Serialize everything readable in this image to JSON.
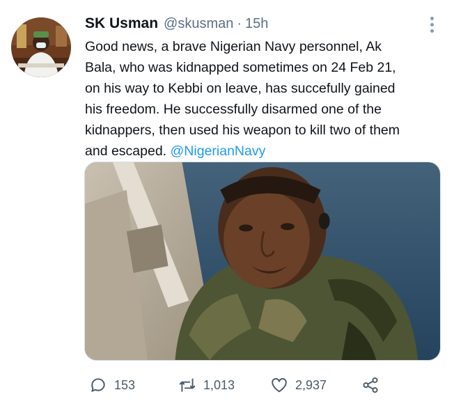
{
  "author": {
    "name": "SK Usman",
    "handle": "@skusman",
    "separator": "·",
    "time": "15h"
  },
  "tweet": {
    "lines": [
      "Good news, a brave Nigerian Navy personnel, Ak",
      "Bala, who was kidnapped sometimes on 24 Feb 21,",
      "on his way to Kebbi on leave, has succefully gained",
      "his freedom.  He successfully disarmed one of the",
      "kidnappers, then used his weapon to kill two of them"
    ],
    "last_line_text": "and escaped. ",
    "mention": "@NigerianNavy"
  },
  "actions": {
    "replies": "153",
    "retweets": "1,013",
    "likes": "2,937"
  },
  "icons": {
    "avatar": "profile-photo",
    "more": "vertical-dots-icon",
    "reply": "reply-bubble-icon",
    "retweet": "retweet-icon",
    "like": "heart-icon",
    "share": "share-icon"
  },
  "colors": {
    "text": "#0f1419",
    "secondary": "#5b7083",
    "link": "#1d9bf0",
    "icon": "#4a5a69"
  }
}
